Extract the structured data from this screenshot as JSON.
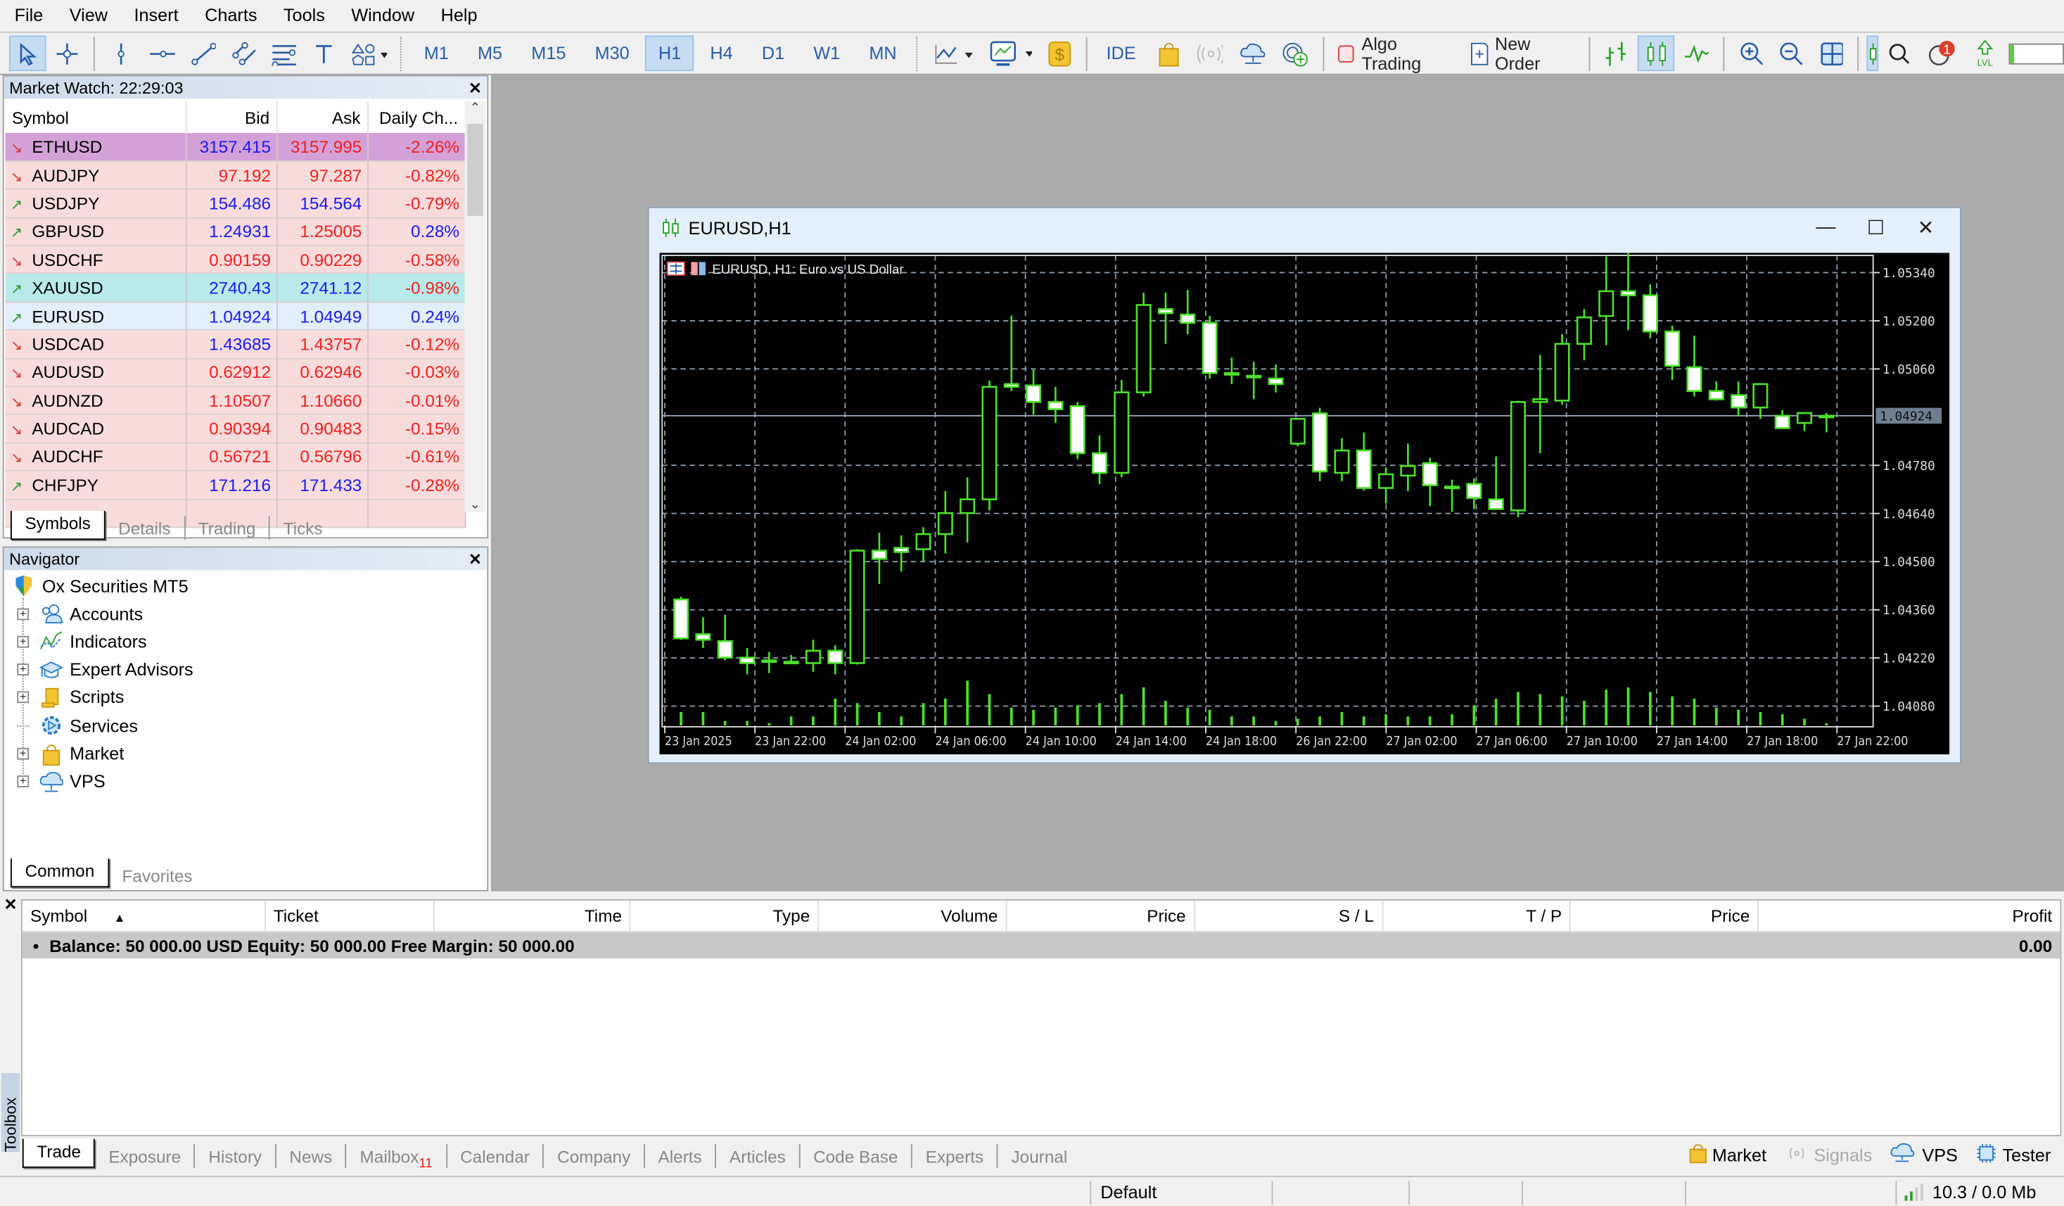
{
  "menu": [
    "File",
    "View",
    "Insert",
    "Charts",
    "Tools",
    "Window",
    "Help"
  ],
  "toolbar": {
    "timeframes": [
      "M1",
      "M5",
      "M15",
      "M30",
      "H1",
      "H4",
      "D1",
      "W1",
      "MN"
    ],
    "active_timeframe": "H1",
    "ide_label": "IDE",
    "algo_trading_label": "Algo Trading",
    "new_order_label": "New Order",
    "notification_count": "1"
  },
  "market_watch": {
    "title": "Market Watch: 22:29:03",
    "columns": [
      "Symbol",
      "Bid",
      "Ask",
      "Daily Ch..."
    ],
    "rows": [
      {
        "symbol": "ETHUSD",
        "dir": "down",
        "bid": "3157.415",
        "ask": "3157.995",
        "change": "-2.26%",
        "bid_color": "blue",
        "ask_color": "red",
        "change_color": "red",
        "bg": "#d4a0d8"
      },
      {
        "symbol": "AUDJPY",
        "dir": "down",
        "bid": "97.192",
        "ask": "97.287",
        "change": "-0.82%",
        "bid_color": "red",
        "ask_color": "red",
        "change_color": "red",
        "bg": "#f8dcdc"
      },
      {
        "symbol": "USDJPY",
        "dir": "up",
        "bid": "154.486",
        "ask": "154.564",
        "change": "-0.79%",
        "bid_color": "blue",
        "ask_color": "blue",
        "change_color": "red",
        "bg": "#f8dcdc"
      },
      {
        "symbol": "GBPUSD",
        "dir": "up",
        "bid": "1.24931",
        "ask": "1.25005",
        "change": "0.28%",
        "bid_color": "blue",
        "ask_color": "red",
        "change_color": "blue",
        "bg": "#f8dcdc"
      },
      {
        "symbol": "USDCHF",
        "dir": "down",
        "bid": "0.90159",
        "ask": "0.90229",
        "change": "-0.58%",
        "bid_color": "red",
        "ask_color": "red",
        "change_color": "red",
        "bg": "#f8dcdc"
      },
      {
        "symbol": "XAUUSD",
        "dir": "up",
        "bid": "2740.43",
        "ask": "2741.12",
        "change": "-0.98%",
        "bid_color": "blue",
        "ask_color": "blue",
        "change_color": "red",
        "bg": "#b8eaea"
      },
      {
        "symbol": "EURUSD",
        "dir": "up",
        "bid": "1.04924",
        "ask": "1.04949",
        "change": "0.24%",
        "bid_color": "blue",
        "ask_color": "blue",
        "change_color": "blue",
        "bg": "#e2eefa"
      },
      {
        "symbol": "USDCAD",
        "dir": "down",
        "bid": "1.43685",
        "ask": "1.43757",
        "change": "-0.12%",
        "bid_color": "blue",
        "ask_color": "red",
        "change_color": "red",
        "bg": "#f8dcdc"
      },
      {
        "symbol": "AUDUSD",
        "dir": "down",
        "bid": "0.62912",
        "ask": "0.62946",
        "change": "-0.03%",
        "bid_color": "red",
        "ask_color": "red",
        "change_color": "red",
        "bg": "#f8dcdc"
      },
      {
        "symbol": "AUDNZD",
        "dir": "down",
        "bid": "1.10507",
        "ask": "1.10660",
        "change": "-0.01%",
        "bid_color": "red",
        "ask_color": "red",
        "change_color": "red",
        "bg": "#f8dcdc"
      },
      {
        "symbol": "AUDCAD",
        "dir": "down",
        "bid": "0.90394",
        "ask": "0.90483",
        "change": "-0.15%",
        "bid_color": "red",
        "ask_color": "red",
        "change_color": "red",
        "bg": "#f8dcdc"
      },
      {
        "symbol": "AUDCHF",
        "dir": "down",
        "bid": "0.56721",
        "ask": "0.56796",
        "change": "-0.61%",
        "bid_color": "red",
        "ask_color": "red",
        "change_color": "red",
        "bg": "#f8dcdc"
      },
      {
        "symbol": "CHFJPY",
        "dir": "up",
        "bid": "171.216",
        "ask": "171.433",
        "change": "-0.28%",
        "bid_color": "blue",
        "ask_color": "blue",
        "change_color": "red",
        "bg": "#f8dcdc"
      }
    ],
    "tabs": [
      "Symbols",
      "Details",
      "Trading",
      "Ticks"
    ],
    "active_tab": "Symbols"
  },
  "navigator": {
    "title": "Navigator",
    "root": "Ox Securities MT5",
    "items": [
      {
        "label": "Accounts",
        "icon": "accounts-icon",
        "expandable": true
      },
      {
        "label": "Indicators",
        "icon": "indicators-icon",
        "expandable": true
      },
      {
        "label": "Expert Advisors",
        "icon": "expert-advisors-icon",
        "expandable": true
      },
      {
        "label": "Scripts",
        "icon": "scripts-icon",
        "expandable": true
      },
      {
        "label": "Services",
        "icon": "services-icon",
        "expandable": false
      },
      {
        "label": "Market",
        "icon": "market-icon",
        "expandable": true
      },
      {
        "label": "VPS",
        "icon": "vps-icon",
        "expandable": true
      }
    ],
    "tabs": [
      "Common",
      "Favorites"
    ],
    "active_tab": "Common"
  },
  "chart_window": {
    "title": "EURUSD,H1",
    "legend": "EURUSD, H1:  Euro vs US Dollar"
  },
  "chart_data": {
    "type": "candlestick",
    "title": "EURUSD, H1: Euro vs US Dollar",
    "symbol": "EURUSD",
    "timeframe": "H1",
    "y_ticks": [
      "1.05340",
      "1.05200",
      "1.05060",
      "1.04780",
      "1.04640",
      "1.04500",
      "1.04360",
      "1.04220",
      "1.04080"
    ],
    "ylim": [
      1.0402,
      1.0539
    ],
    "current_price": "1.04924",
    "x_ticks": [
      "23 Jan 2025",
      "23 Jan 22:00",
      "24 Jan 02:00",
      "24 Jan 06:00",
      "24 Jan 10:00",
      "24 Jan 14:00",
      "24 Jan 18:00",
      "26 Jan 22:00",
      "27 Jan 02:00",
      "27 Jan 06:00",
      "27 Jan 10:00",
      "27 Jan 14:00",
      "27 Jan 18:00",
      "27 Jan 22:00"
    ],
    "grid": true,
    "colors": {
      "background": "#000000",
      "candle_outline": "#4ce02a",
      "bear_fill": "#ffffff",
      "bull_fill": "#000000",
      "grid": "#8a9aa8",
      "volume": "#4ce02a"
    },
    "candles": [
      {
        "o": 1.0439,
        "h": 1.04398,
        "l": 1.04273,
        "c": 1.04277
      },
      {
        "o": 1.04289,
        "h": 1.04338,
        "l": 1.04249,
        "c": 1.04273
      },
      {
        "o": 1.04269,
        "h": 1.04346,
        "l": 1.04213,
        "c": 1.04221
      },
      {
        "o": 1.04221,
        "h": 1.04249,
        "l": 1.04172,
        "c": 1.04205
      },
      {
        "o": 1.04213,
        "h": 1.04237,
        "l": 1.04176,
        "c": 1.04213
      },
      {
        "o": 1.04209,
        "h": 1.04229,
        "l": 1.04205,
        "c": 1.04209
      },
      {
        "o": 1.04205,
        "h": 1.04273,
        "l": 1.0418,
        "c": 1.04241
      },
      {
        "o": 1.04241,
        "h": 1.04257,
        "l": 1.04172,
        "c": 1.04205
      },
      {
        "o": 1.04205,
        "h": 1.04536,
        "l": 1.04201,
        "c": 1.04532
      },
      {
        "o": 1.04532,
        "h": 1.04584,
        "l": 1.04435,
        "c": 1.04508
      },
      {
        "o": 1.0454,
        "h": 1.04576,
        "l": 1.04471,
        "c": 1.04528
      },
      {
        "o": 1.04536,
        "h": 1.046,
        "l": 1.04499,
        "c": 1.0458
      },
      {
        "o": 1.0458,
        "h": 1.04705,
        "l": 1.04524,
        "c": 1.04641
      },
      {
        "o": 1.04641,
        "h": 1.04745,
        "l": 1.04556,
        "c": 1.04681
      },
      {
        "o": 1.04681,
        "h": 1.05026,
        "l": 1.04649,
        "c": 1.05008
      },
      {
        "o": 1.05016,
        "h": 1.05215,
        "l": 1.04996,
        "c": 1.05008
      },
      {
        "o": 1.05012,
        "h": 1.05058,
        "l": 1.04927,
        "c": 1.04964
      },
      {
        "o": 1.04964,
        "h": 1.05008,
        "l": 1.04903,
        "c": 1.04943
      },
      {
        "o": 1.04952,
        "h": 1.04964,
        "l": 1.04798,
        "c": 1.04815
      },
      {
        "o": 1.04815,
        "h": 1.04867,
        "l": 1.04725,
        "c": 1.04758
      },
      {
        "o": 1.04758,
        "h": 1.05028,
        "l": 1.04745,
        "c": 1.04992
      },
      {
        "o": 1.04992,
        "h": 1.05282,
        "l": 1.0498,
        "c": 1.05246
      },
      {
        "o": 1.05234,
        "h": 1.05282,
        "l": 1.05133,
        "c": 1.05222
      },
      {
        "o": 1.05218,
        "h": 1.0529,
        "l": 1.05161,
        "c": 1.05194
      },
      {
        "o": 1.05194,
        "h": 1.05214,
        "l": 1.05032,
        "c": 1.05048
      },
      {
        "o": 1.05048,
        "h": 1.05093,
        "l": 1.05016,
        "c": 1.05048
      },
      {
        "o": 1.0504,
        "h": 1.05081,
        "l": 1.04972,
        "c": 1.0504
      },
      {
        "o": 1.05032,
        "h": 1.05073,
        "l": 1.04992,
        "c": 1.05016
      },
      {
        "o": 1.04843,
        "h": 1.04831,
        "l": 1.04835,
        "c": 1.04915
      },
      {
        "o": 1.04931,
        "h": 1.04947,
        "l": 1.04734,
        "c": 1.04762
      },
      {
        "o": 1.04758,
        "h": 1.04859,
        "l": 1.04734,
        "c": 1.04823
      },
      {
        "o": 1.04823,
        "h": 1.04875,
        "l": 1.04706,
        "c": 1.04714
      },
      {
        "o": 1.04714,
        "h": 1.04774,
        "l": 1.04669,
        "c": 1.04754
      },
      {
        "o": 1.0475,
        "h": 1.04843,
        "l": 1.04705,
        "c": 1.04778
      },
      {
        "o": 1.04786,
        "h": 1.04802,
        "l": 1.04661,
        "c": 1.04722
      },
      {
        "o": 1.04718,
        "h": 1.04738,
        "l": 1.04645,
        "c": 1.04718
      },
      {
        "o": 1.04726,
        "h": 1.04742,
        "l": 1.04653,
        "c": 1.04685
      },
      {
        "o": 1.04681,
        "h": 1.04806,
        "l": 1.04669,
        "c": 1.04653
      },
      {
        "o": 1.04649,
        "h": 1.04968,
        "l": 1.04629,
        "c": 1.04964
      },
      {
        "o": 1.04964,
        "h": 1.05101,
        "l": 1.04815,
        "c": 1.04972
      },
      {
        "o": 1.04968,
        "h": 1.05161,
        "l": 1.04956,
        "c": 1.05133
      },
      {
        "o": 1.05133,
        "h": 1.05234,
        "l": 1.05085,
        "c": 1.0521
      },
      {
        "o": 1.05214,
        "h": 1.05387,
        "l": 1.05129,
        "c": 1.05286
      },
      {
        "o": 1.05286,
        "h": 1.05408,
        "l": 1.05173,
        "c": 1.05274
      },
      {
        "o": 1.05274,
        "h": 1.05306,
        "l": 1.05149,
        "c": 1.05169
      },
      {
        "o": 1.05169,
        "h": 1.05186,
        "l": 1.05028,
        "c": 1.05069
      },
      {
        "o": 1.05065,
        "h": 1.05157,
        "l": 1.0498,
        "c": 1.04996
      },
      {
        "o": 1.04996,
        "h": 1.05024,
        "l": 1.04968,
        "c": 1.04972
      },
      {
        "o": 1.04984,
        "h": 1.05024,
        "l": 1.04923,
        "c": 1.04948
      },
      {
        "o": 1.04948,
        "h": 1.05016,
        "l": 1.04915,
        "c": 1.05016
      },
      {
        "o": 1.04924,
        "h": 1.0494,
        "l": 1.04911,
        "c": 1.04888
      },
      {
        "o": 1.04903,
        "h": 1.04932,
        "l": 1.0488,
        "c": 1.04932
      },
      {
        "o": 1.04924,
        "h": 1.04932,
        "l": 1.04876,
        "c": 1.04924
      }
    ],
    "volumes_relative": [
      0.3,
      0.3,
      0.1,
      0.1,
      0.05,
      0.2,
      0.2,
      0.6,
      0.5,
      0.3,
      0.2,
      0.5,
      0.6,
      1.0,
      0.7,
      0.4,
      0.35,
      0.4,
      0.45,
      0.5,
      0.7,
      0.85,
      0.55,
      0.4,
      0.35,
      0.2,
      0.2,
      0.1,
      0.15,
      0.2,
      0.3,
      0.2,
      0.25,
      0.2,
      0.2,
      0.25,
      0.45,
      0.6,
      0.75,
      0.7,
      0.65,
      0.55,
      0.8,
      0.85,
      0.75,
      0.65,
      0.6,
      0.4,
      0.35,
      0.3,
      0.25,
      0.15,
      0.05
    ]
  },
  "toolbox": {
    "side_label": "Toolbox",
    "columns": [
      "Symbol",
      "Ticket",
      "Time",
      "Type",
      "Volume",
      "Price",
      "S / L",
      "T / P",
      "Price",
      "Profit"
    ],
    "sort_indicator": "▲",
    "balance_line": "Balance: 50 000.00 USD  Equity: 50 000.00  Free Margin: 50 000.00",
    "profit_total": "0.00",
    "tabs": [
      {
        "label": "Trade",
        "badge": ""
      },
      {
        "label": "Exposure",
        "badge": ""
      },
      {
        "label": "History",
        "badge": ""
      },
      {
        "label": "News",
        "badge": ""
      },
      {
        "label": "Mailbox",
        "badge": "11"
      },
      {
        "label": "Calendar",
        "badge": ""
      },
      {
        "label": "Company",
        "badge": ""
      },
      {
        "label": "Alerts",
        "badge": ""
      },
      {
        "label": "Articles",
        "badge": ""
      },
      {
        "label": "Code Base",
        "badge": ""
      },
      {
        "label": "Experts",
        "badge": ""
      },
      {
        "label": "Journal",
        "badge": ""
      }
    ],
    "active_tab": "Trade",
    "right_links": [
      {
        "label": "Market",
        "icon": "market-bag-icon",
        "enabled": true
      },
      {
        "label": "Signals",
        "icon": "signals-icon",
        "enabled": false
      },
      {
        "label": "VPS",
        "icon": "vps-cloud-icon",
        "enabled": true
      },
      {
        "label": "Tester",
        "icon": "tester-chip-icon",
        "enabled": true
      }
    ]
  },
  "statusbar": {
    "profile": "Default",
    "traffic": "10.3 / 0.0 Mb"
  }
}
